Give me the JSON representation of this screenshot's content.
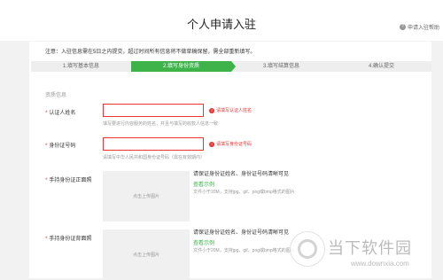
{
  "header": {
    "title": "个人申请入驻",
    "help_text": "申请入驻帮助"
  },
  "notice": {
    "prefix": "注意：",
    "text": "入驻信息需在5日之内提交，超过时间所有信息将不做草稿保留，需全部重新填写。"
  },
  "steps": [
    {
      "label": "1.填写基本信息",
      "active": false
    },
    {
      "label": "2.填写身份资质",
      "active": true
    },
    {
      "label": "3.填写结算信息",
      "active": false
    },
    {
      "label": "4.确认提交",
      "active": false
    }
  ],
  "section": {
    "title": "资质信息"
  },
  "form": {
    "name": {
      "label": "认证人姓名",
      "value": "",
      "error": "请填写认证人姓名",
      "hint": "填写要进行内容服务的姓名，并且与填写的收款人信息一致"
    },
    "id_number": {
      "label": "身份证号码",
      "value": "",
      "error": "请填写身份证号码",
      "hint": "请填写中华人民共和国身份证号码（需在有效期内）"
    },
    "id_front": {
      "label": "手持身份证正面照",
      "upload": "点击上传图片",
      "desc": "请保证身份证姓名、身份证号码清晰可见",
      "example": "查看示例",
      "req": "文件小于20M，支持jpg、gif、png或bmp格式的图片"
    },
    "id_back": {
      "label": "手持身份证背面照",
      "upload": "点击上传图片",
      "desc": "请保证身份证姓名、身份证号码清晰可见",
      "example": "查看示例",
      "req": "文件小于20M，支持jpg、gif、png或bmp格式的图片"
    }
  },
  "watermark": {
    "title": "当下软件园",
    "url": "www.downxia.com"
  },
  "colors": {
    "accent": "#3db34a",
    "error": "#e33333"
  }
}
